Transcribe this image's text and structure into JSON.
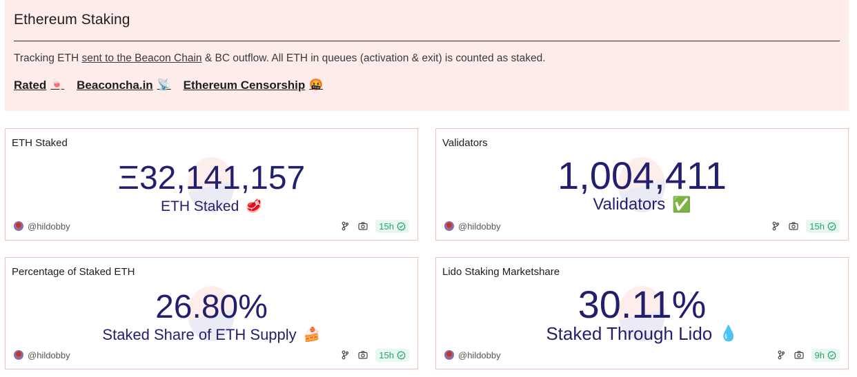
{
  "header": {
    "title": "Ethereum Staking",
    "description_prefix": "Tracking ETH ",
    "description_link": "sent to the Beacon Chain",
    "description_suffix": " & BC outflow. All ETH in queues (activation & exit) is counted as staked.",
    "links": [
      {
        "label": "Rated",
        "emoji": "🍬",
        "icon": "candy-icon"
      },
      {
        "label": "Beaconcha.in",
        "emoji": "📡",
        "icon": "satellite-antenna-icon"
      },
      {
        "label": "Ethereum Censorship",
        "emoji": "🤬",
        "icon": "angry-face-icon"
      }
    ]
  },
  "cards": [
    {
      "title": "ETH Staked",
      "value": "Ξ32,141,157",
      "subtitle": "ETH Staked",
      "emoji": "🥩",
      "emoji_icon": "meat-icon",
      "author": "@hildobby",
      "age": "15h"
    },
    {
      "title": "Validators",
      "value": "1,004,411",
      "subtitle": "Validators",
      "emoji": "✅",
      "emoji_icon": "check-mark-icon",
      "author": "@hildobby",
      "age": "15h"
    },
    {
      "title": "Percentage of Staked ETH",
      "value": "26.80%",
      "subtitle": "Staked Share of ETH Supply",
      "emoji": "🍰",
      "emoji_icon": "cake-icon",
      "author": "@hildobby",
      "age": "15h"
    },
    {
      "title": "Lido Staking Marketshare",
      "value": "30.11%",
      "subtitle": "Staked Through Lido",
      "emoji": "💧",
      "emoji_icon": "droplet-icon",
      "author": "@hildobby",
      "age": "9h"
    }
  ],
  "colors": {
    "header_bg": "#fdecea",
    "card_border": "#f4c2b5",
    "value_text": "#221f6e",
    "badge_bg": "#e8f7ef",
    "badge_text": "#2aa56a"
  }
}
